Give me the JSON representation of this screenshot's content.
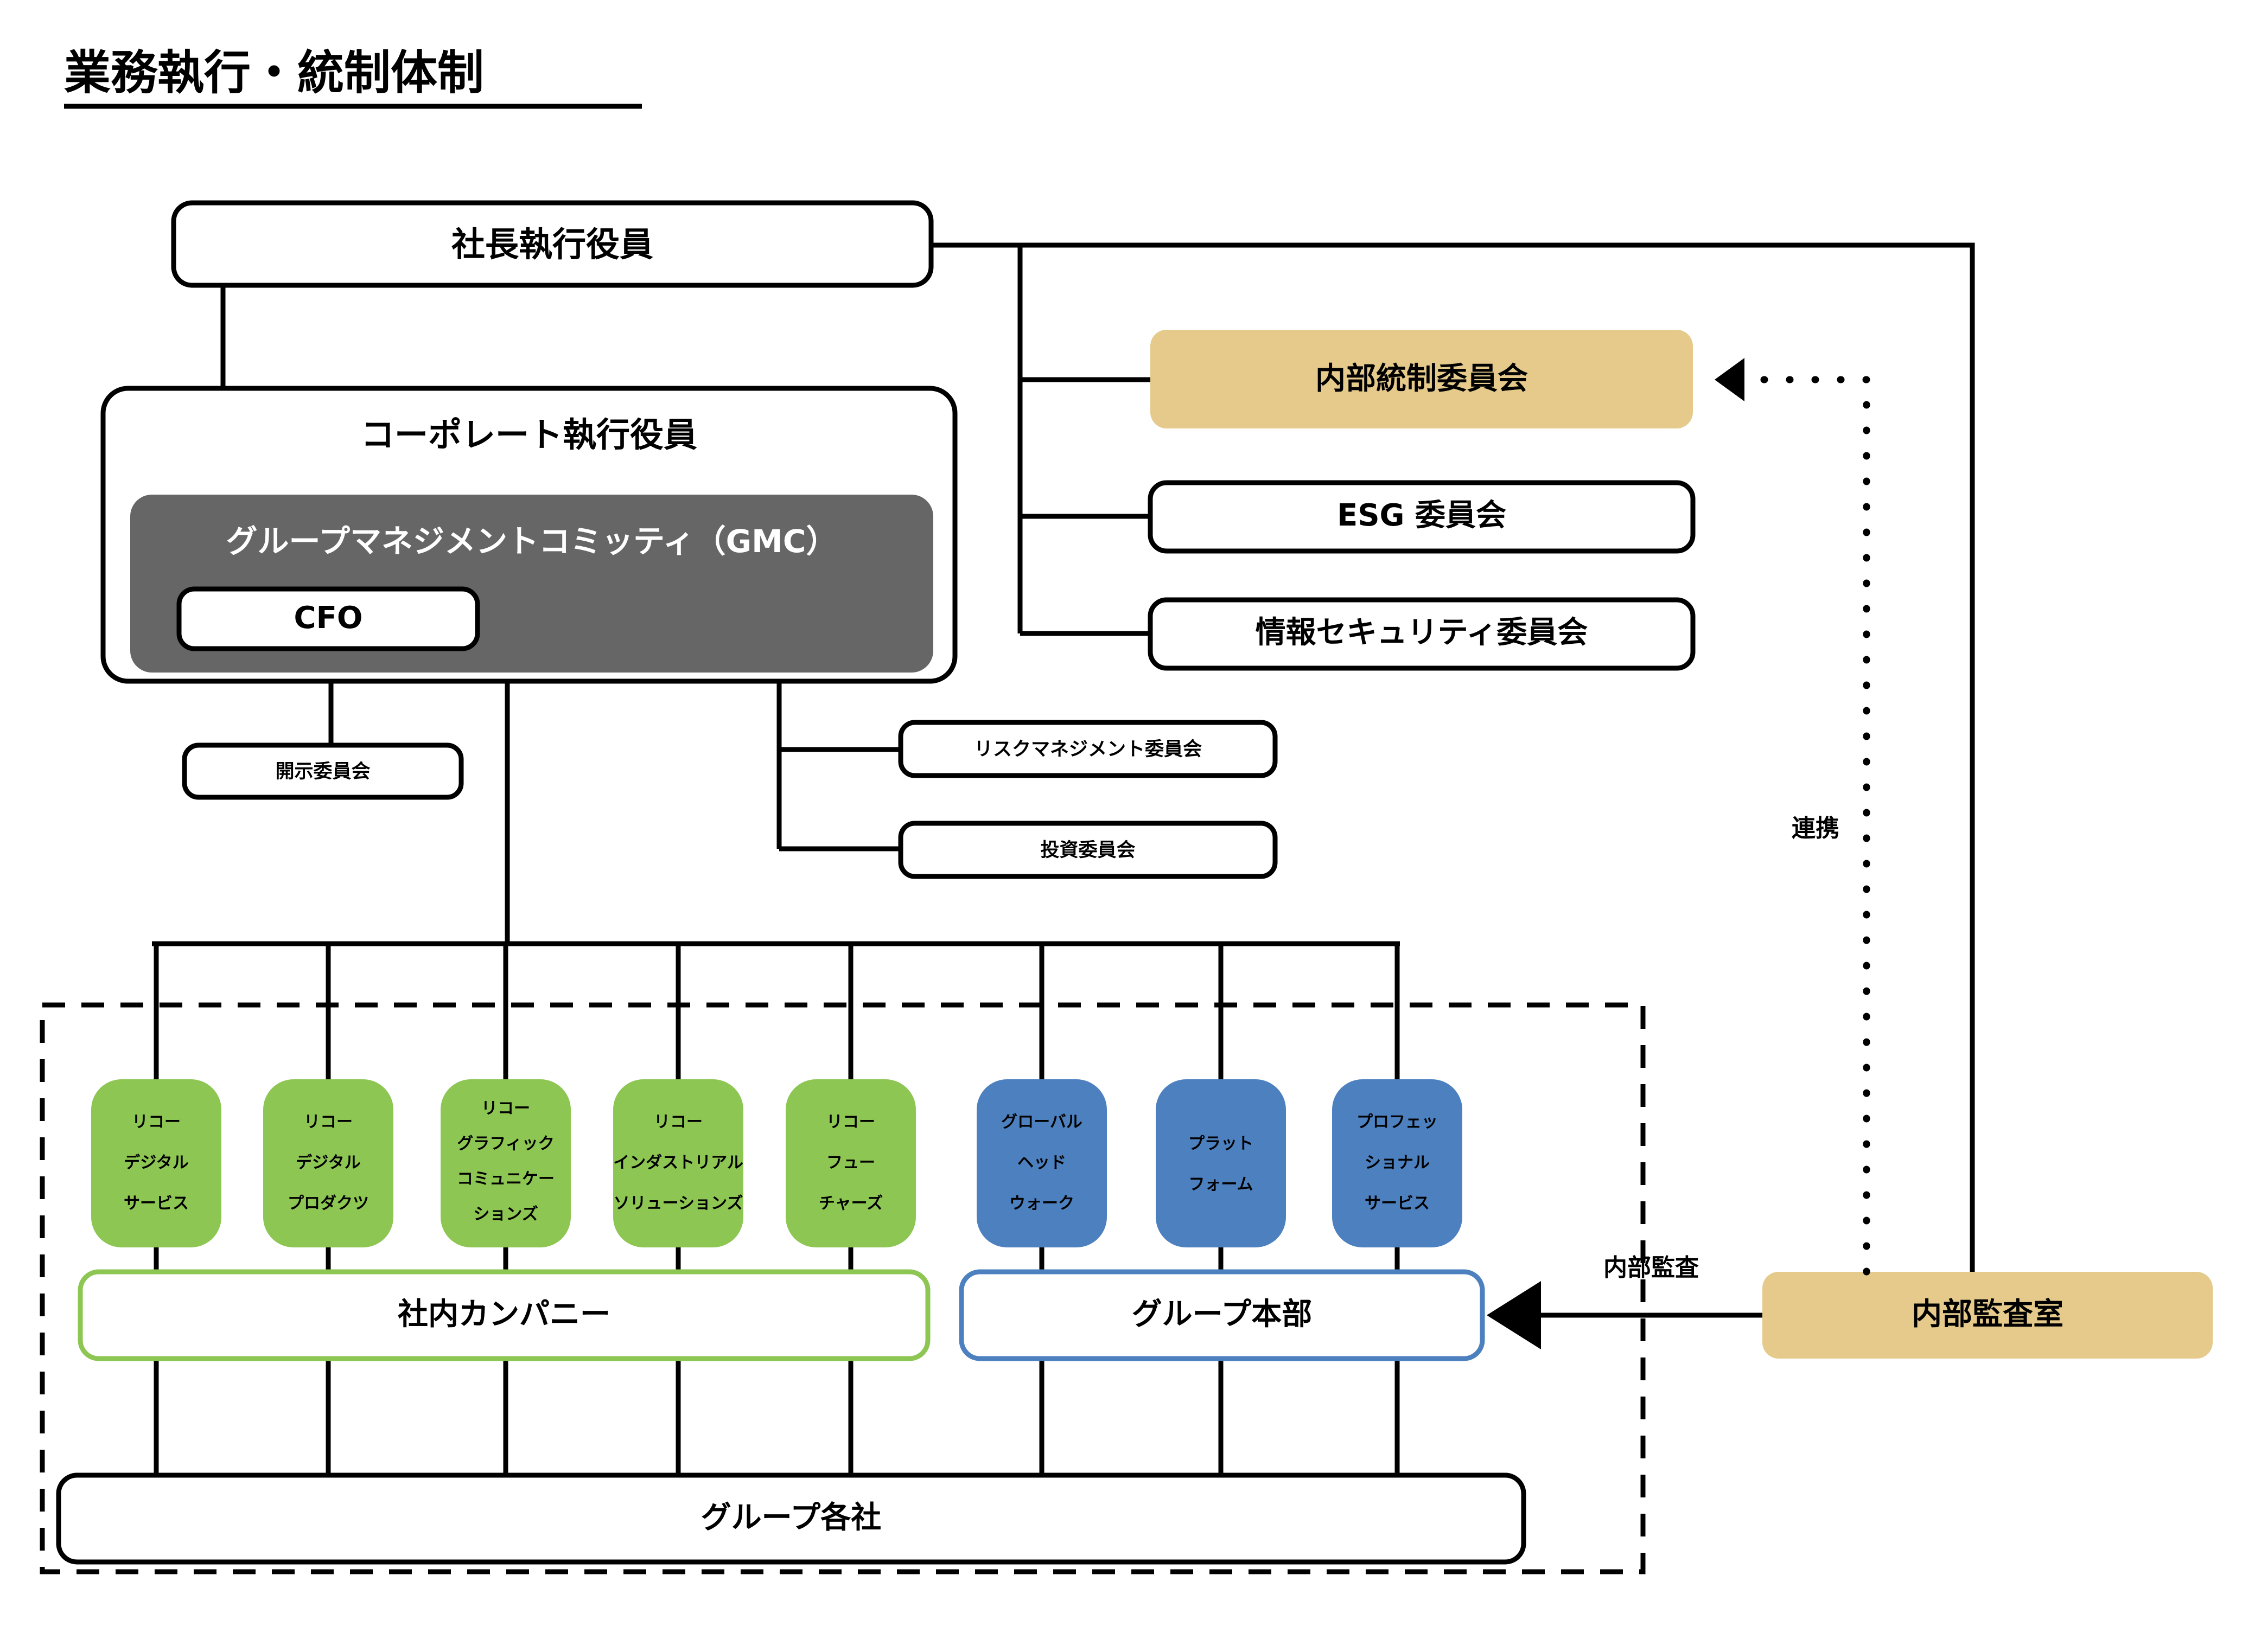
{
  "title": "業務執行・統制体制",
  "nodes": {
    "president": "社長執行役員",
    "corporate_officers": "コーポレート執行役員",
    "gmc": "グループマネジメントコミッティ（GMC）",
    "cfo": "CFO",
    "internal_control_committee": "内部統制委員会",
    "esg_committee": "ESG 委員会",
    "infosec_committee": "情報セキュリティ委員会",
    "disclosure_committee": "開示委員会",
    "risk_management_committee": "リスクマネジメント委員会",
    "investment_committee": "投資委員会",
    "internal_company_band": "社内カンパニー",
    "group_hq_band": "グループ本部",
    "group_companies": "グループ各社",
    "internal_audit_office": "内部監査室"
  },
  "edge_labels": {
    "coordination": "連携",
    "internal_audit": "内部監査"
  },
  "companies": [
    {
      "lines": [
        "リコー",
        "デジタル",
        "サービス"
      ],
      "group": "internal-company"
    },
    {
      "lines": [
        "リコー",
        "デジタル",
        "プロダクツ"
      ],
      "group": "internal-company"
    },
    {
      "lines": [
        "リコー",
        "グラフィック",
        "コミュニケー",
        "ションズ"
      ],
      "group": "internal-company"
    },
    {
      "lines": [
        "リコー",
        "インダストリアル",
        "ソリューションズ"
      ],
      "group": "internal-company"
    },
    {
      "lines": [
        "リコー",
        "フュー",
        "チャーズ"
      ],
      "group": "internal-company"
    },
    {
      "lines": [
        "グローバル",
        "ヘッド",
        "ウォーク"
      ],
      "group": "group-hq"
    },
    {
      "lines": [
        "プラット",
        "フォーム"
      ],
      "group": "group-hq"
    },
    {
      "lines": [
        "プロフェッ",
        "ショナル",
        "サービス"
      ],
      "group": "group-hq"
    }
  ],
  "colors": {
    "internal_company_green": "#8dc653",
    "group_hq_blue": "#4d80bf",
    "highlight_tan": "#e5ca8c",
    "gmc_gray": "#666666",
    "line_black": "#000000",
    "background": "#ffffff"
  }
}
